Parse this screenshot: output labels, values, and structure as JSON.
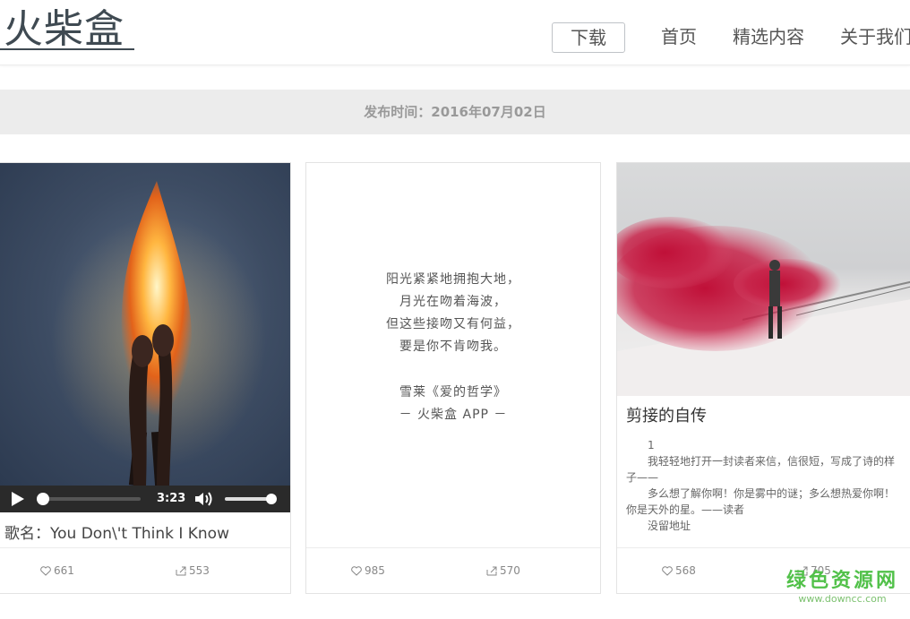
{
  "header": {
    "logo": "火柴盒",
    "download_label": "下载",
    "nav": {
      "home": "首页",
      "featured": "精选内容",
      "about": "关于我们"
    }
  },
  "date_bar": {
    "text": "发布时间：2016年07月02日"
  },
  "cards": [
    {
      "type": "music",
      "song_title": "歌名：You Don\\'t Think I Know",
      "player": {
        "time": "3:23",
        "progress": 0.05,
        "volume": 0.9
      },
      "likes": "661",
      "shares": "553"
    },
    {
      "type": "poem",
      "lines": [
        "阳光紧紧地拥抱大地，",
        "月光在吻着海波，",
        "但这些接吻又有何益，",
        "要是你不肯吻我。"
      ],
      "source": "雪莱《爱的哲学》",
      "app": "－ 火柴盒 APP －",
      "likes": "985",
      "shares": "570"
    },
    {
      "type": "article",
      "title": "剪接的自传",
      "paragraphs": [
        "1",
        "我轻轻地打开一封读者来信，信很短，写成了诗的样子——",
        "多么想了解你啊！你是雾中的谜；多么想热爱你啊！你是天外的星。——读者",
        "没留地址"
      ],
      "likes": "568",
      "shares": "705"
    }
  ],
  "watermark": {
    "name": "绿色资源网",
    "url": "www.downcc.com"
  },
  "colors": {
    "brand_dark": "#3f4a52",
    "date_bar_bg": "#ececec",
    "watermark_green": "#52c14a"
  }
}
